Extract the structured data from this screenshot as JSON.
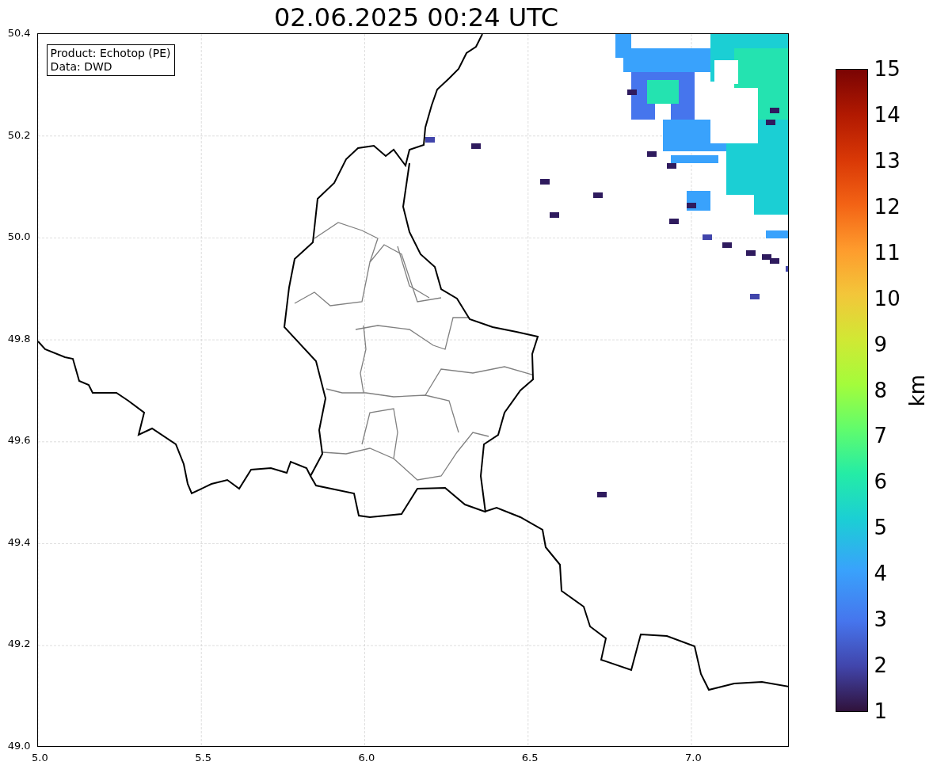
{
  "title": "02.06.2025 00:24 UTC",
  "info_box": [
    "Product: Echotop (PE)",
    "Data: DWD"
  ],
  "map": {
    "x_ticks": [
      "5.0",
      "5.5",
      "6.0",
      "6.5",
      "7.0"
    ],
    "y_ticks": [
      "50.4",
      "50.2",
      "50.0",
      "49.8",
      "49.6",
      "49.4",
      "49.2",
      "49.0"
    ]
  },
  "colorbar": {
    "label": "km",
    "ticks": [
      "15",
      "14",
      "13",
      "12",
      "11",
      "10",
      "9",
      "8",
      "7",
      "6",
      "5",
      "4",
      "3",
      "2",
      "1"
    ]
  }
}
